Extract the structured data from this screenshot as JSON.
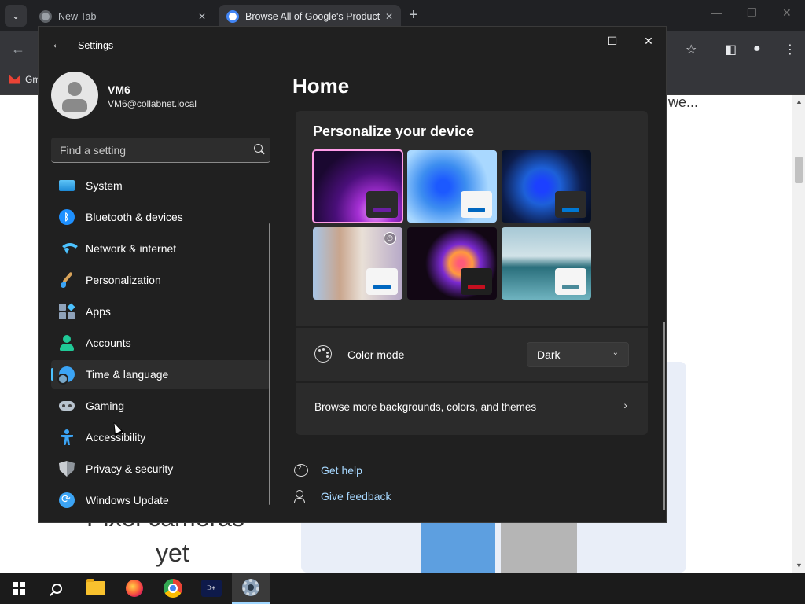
{
  "browser": {
    "tabs": [
      {
        "title": "New Tab"
      },
      {
        "title": "Browse All of Google's Products"
      }
    ],
    "bookmarks": [
      {
        "label": "Gm"
      }
    ],
    "page": {
      "top_text": "we...",
      "hero_line_1": "Pixel cameras",
      "hero_line_2": "yet"
    }
  },
  "settings": {
    "app_title": "Settings",
    "profile": {
      "name": "VM6",
      "email": "VM6@collabnet.local"
    },
    "search": {
      "placeholder": "Find a setting"
    },
    "nav": [
      {
        "label": "System",
        "icon": "monitor-icon"
      },
      {
        "label": "Bluetooth & devices",
        "icon": "bluetooth-icon"
      },
      {
        "label": "Network & internet",
        "icon": "wifi-icon"
      },
      {
        "label": "Personalization",
        "icon": "brush-icon"
      },
      {
        "label": "Apps",
        "icon": "apps-icon"
      },
      {
        "label": "Accounts",
        "icon": "person-icon"
      },
      {
        "label": "Time & language",
        "icon": "globe-clock-icon",
        "active": true
      },
      {
        "label": "Gaming",
        "icon": "gamepad-icon"
      },
      {
        "label": "Accessibility",
        "icon": "accessibility-icon"
      },
      {
        "label": "Privacy & security",
        "icon": "shield-icon"
      },
      {
        "label": "Windows Update",
        "icon": "update-icon"
      }
    ],
    "page_title": "Home",
    "personalize": {
      "heading": "Personalize your device",
      "themes": [
        {
          "name": "windows-bloom-purple",
          "accent": "#6b1fa3",
          "selected": true
        },
        {
          "name": "windows-light",
          "accent": "#0067c0"
        },
        {
          "name": "windows-dark",
          "accent": "#0078d4"
        },
        {
          "name": "glow-floral",
          "accent": "#0067c0"
        },
        {
          "name": "captured-motion",
          "accent": "#c50f1f"
        },
        {
          "name": "flow-lake",
          "accent": "#4a8a9a"
        }
      ],
      "color_mode_label": "Color mode",
      "color_mode_value": "Dark",
      "browse_label": "Browse more backgrounds, colors, and themes"
    },
    "help_links": [
      {
        "label": "Get help"
      },
      {
        "label": "Give feedback"
      }
    ]
  },
  "taskbar": {
    "items": [
      "start",
      "search",
      "file-explorer",
      "firefox",
      "chrome",
      "disney-plus",
      "settings"
    ],
    "active": "settings"
  }
}
